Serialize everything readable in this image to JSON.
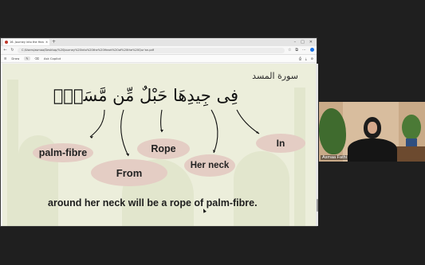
{
  "browser": {
    "tab_title": "16. Journey into the Heart of the...",
    "url": "C:/Users/asmaa/Desktop/%20Journey%20into%20the%20Heart%20of%20the%20Qur'an.pdf",
    "pdf_toolbar": [
      "Draw",
      "Ask Copilot"
    ]
  },
  "slide": {
    "surah_name": "سورة المسد",
    "verse": "فِى جِيدِهَا حَبْلٌ مِّن مَّسَدٍۭ",
    "words": {
      "palm_fibre": "palm-fibre",
      "from": "From",
      "rope": "Rope",
      "her_neck": "Her neck",
      "in": "In"
    },
    "meaning": "around her neck will be a rope of palm-fibre.",
    "colors": {
      "background": "#eceedb",
      "blob": "#e4cdc4",
      "text": "#1e1e1e"
    }
  },
  "participant": {
    "name": "Asmaa Fathi"
  }
}
